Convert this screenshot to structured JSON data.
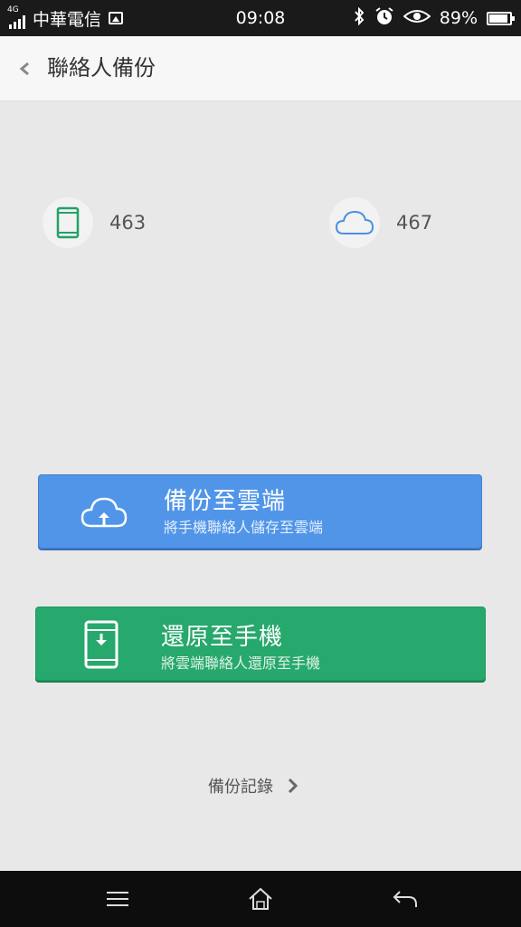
{
  "status_bar": {
    "network": "4G",
    "carrier": "中華電信",
    "time": "09:08",
    "battery": "89%",
    "battery_level": 0.89,
    "icons": [
      "signal-icon",
      "image-notification-icon",
      "bluetooth-icon",
      "alarm-icon",
      "eye-icon",
      "battery-icon"
    ]
  },
  "header": {
    "title": "聯絡人備份",
    "back_icon": "chevron-left-icon"
  },
  "counts": {
    "phone": {
      "icon": "phone-icon",
      "value": "463"
    },
    "cloud": {
      "icon": "cloud-icon",
      "value": "467"
    }
  },
  "actions": {
    "backup": {
      "icon": "cloud-upload-icon",
      "title": "備份至雲端",
      "subtitle": "將手機聯絡人儲存至雲端"
    },
    "restore": {
      "icon": "phone-download-icon",
      "title": "還原至手機",
      "subtitle": "將雲端聯絡人還原至手機"
    }
  },
  "history": {
    "label": "備份記錄",
    "icon": "chevron-right-icon"
  },
  "nav": {
    "menu_icon": "menu-icon",
    "home_icon": "home-icon",
    "back_icon": "back-arrow-icon"
  },
  "colors": {
    "backup_blue": "#5195e8",
    "restore_green": "#27a86c",
    "phone_icon_green": "#21a366",
    "cloud_icon_blue": "#4a90e2"
  }
}
